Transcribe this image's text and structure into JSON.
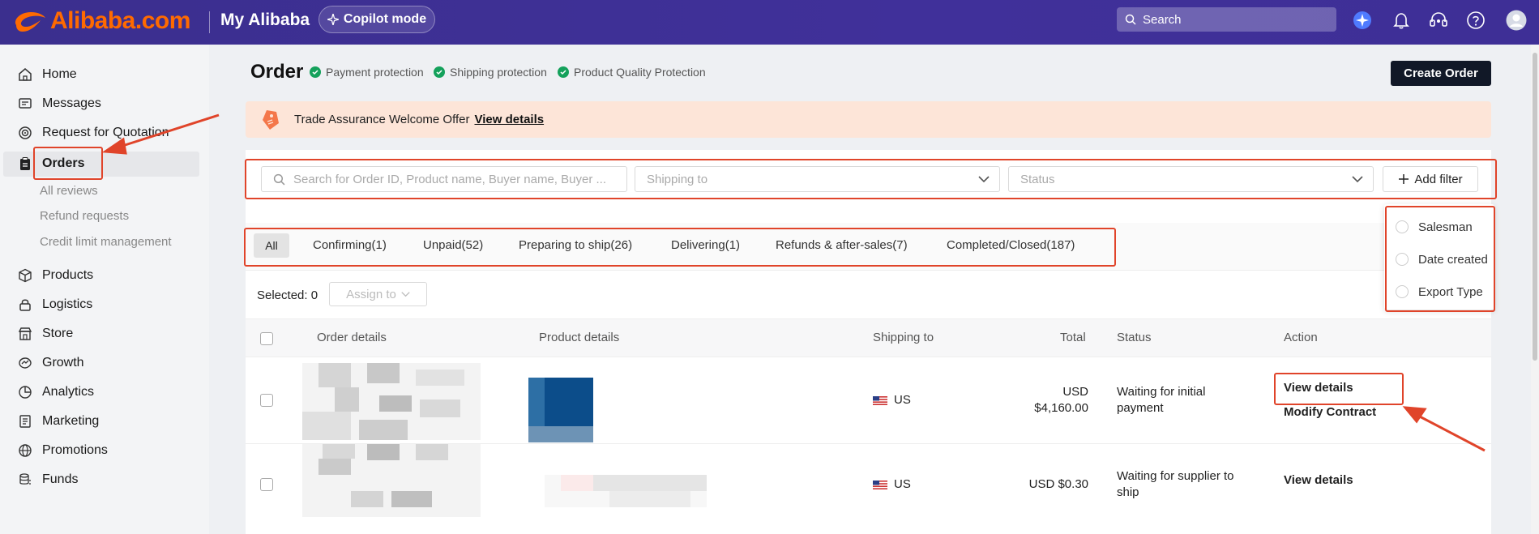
{
  "header": {
    "logo_text": "Alibaba.com",
    "section_title": "My Alibaba",
    "copilot_label": "Copilot mode",
    "search_placeholder": "Search",
    "brand_color": "#ff6a00",
    "icons": [
      "sparkle-icon",
      "bell-icon",
      "headset-icon",
      "help-icon",
      "user-avatar-icon"
    ]
  },
  "sidebar": {
    "items": [
      {
        "label": "Home",
        "icon": "home-icon"
      },
      {
        "label": "Messages",
        "icon": "message-icon"
      },
      {
        "label": "Request for Quotation",
        "icon": "target-icon"
      },
      {
        "label": "Orders",
        "icon": "clipboard-icon"
      },
      {
        "label": "Products",
        "icon": "cube-icon"
      },
      {
        "label": "Logistics",
        "icon": "lock-icon"
      },
      {
        "label": "Store",
        "icon": "store-icon"
      },
      {
        "label": "Growth",
        "icon": "growth-icon"
      },
      {
        "label": "Analytics",
        "icon": "pie-chart-icon"
      },
      {
        "label": "Marketing",
        "icon": "marketing-icon"
      },
      {
        "label": "Promotions",
        "icon": "globe-icon"
      },
      {
        "label": "Funds",
        "icon": "coins-icon"
      }
    ],
    "orders_subitems": [
      "All reviews",
      "Refund requests",
      "Credit limit management"
    ]
  },
  "page": {
    "title": "Order",
    "protections": [
      "Payment protection",
      "Shipping protection",
      "Product Quality Protection"
    ],
    "protection_color": "#14a15b",
    "create_button": "Create Order",
    "banner_text": "Trade Assurance Welcome Offer",
    "banner_link": "View details"
  },
  "filters": {
    "search_placeholder": "Search for Order ID, Product name, Buyer name, Buyer ...",
    "shipping_placeholder": "Shipping to",
    "status_placeholder": "Status",
    "add_filter": "Add filter",
    "dropdown_options": [
      "Salesman",
      "Date created",
      "Export Type"
    ]
  },
  "tabs": [
    {
      "label": "All"
    },
    {
      "label": "Confirming(1)"
    },
    {
      "label": "Unpaid(52)"
    },
    {
      "label": "Preparing to ship(26)"
    },
    {
      "label": "Delivering(1)"
    },
    {
      "label": "Refunds & after-sales(7)"
    },
    {
      "label": "Completed/Closed(187)"
    }
  ],
  "toolbar": {
    "selected_text": "Selected: 0",
    "assign_label": "Assign to"
  },
  "table": {
    "headers": [
      "Order details",
      "Product details",
      "Shipping to",
      "Total",
      "Status",
      "Action"
    ],
    "rows": [
      {
        "shipping": "US",
        "total_line1": "USD",
        "total_line2": "$4,160.00",
        "status_line1": "Waiting for initial",
        "status_line2": "payment",
        "action1": "View details",
        "action2": "Modify Contract"
      },
      {
        "shipping": "US",
        "total_line1": "",
        "total_line2": "USD $0.30",
        "status_line1": "Waiting for supplier to",
        "status_line2": "ship",
        "action1": "View details",
        "action2": ""
      }
    ]
  },
  "annotation_color": "#e0442a"
}
